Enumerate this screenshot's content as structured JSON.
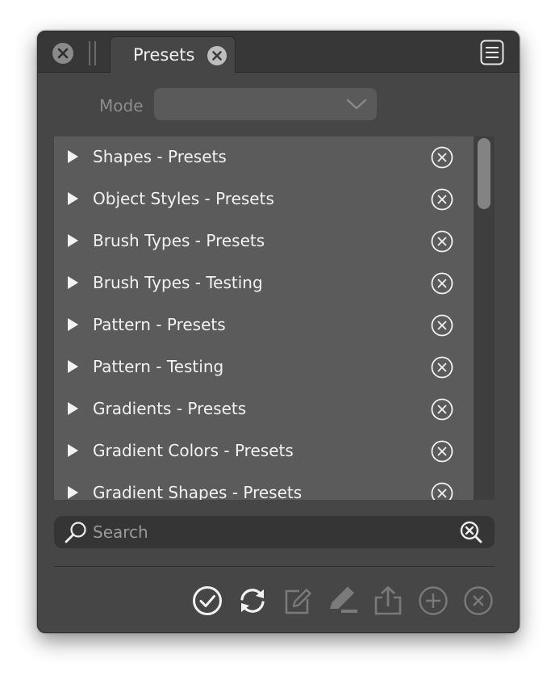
{
  "titlebar": {
    "close_icon": "close-icon",
    "tab_label": "Presets",
    "tab_close_icon": "close-icon",
    "menu_icon": "hamburger-menu-icon"
  },
  "mode": {
    "label": "Mode",
    "selected": ""
  },
  "preset_groups": [
    {
      "label": "Shapes - Presets"
    },
    {
      "label": "Object Styles - Presets"
    },
    {
      "label": "Brush Types - Presets"
    },
    {
      "label": "Brush Types - Testing"
    },
    {
      "label": "Pattern - Presets"
    },
    {
      "label": "Pattern - Testing"
    },
    {
      "label": "Gradients - Presets"
    },
    {
      "label": "Gradient Colors - Presets"
    },
    {
      "label": "Gradient Shapes - Presets"
    }
  ],
  "search": {
    "placeholder": "Search",
    "value": ""
  },
  "toolbar": {
    "icons": [
      "checkmark-circle-icon",
      "refresh-icon",
      "edit-icon",
      "rename-pen-icon",
      "share-icon",
      "add-circle-icon",
      "remove-circle-icon"
    ]
  },
  "colors": {
    "panel_bg": "#464646",
    "list_bg": "#5b5b5b",
    "text": "#f2f2f2",
    "disabled_icon": "#7a7a7a"
  }
}
